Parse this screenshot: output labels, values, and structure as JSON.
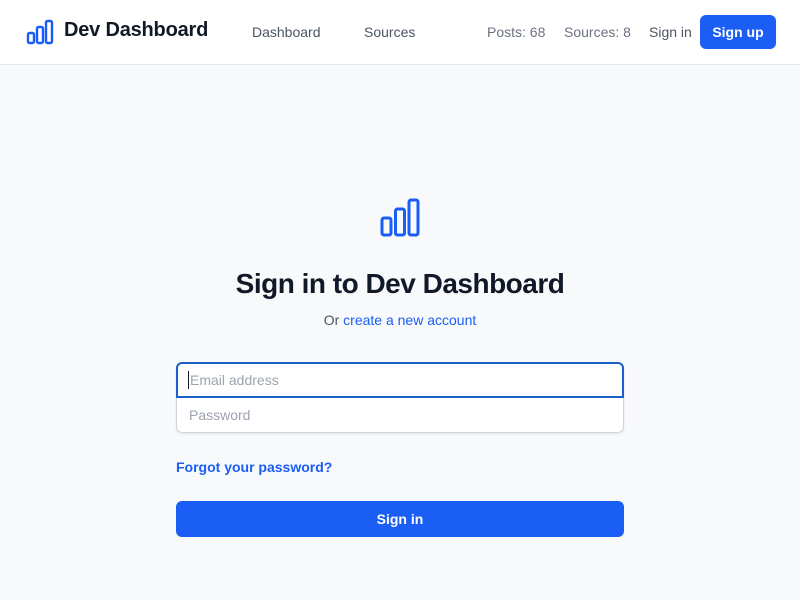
{
  "header": {
    "brand": "Dev Dashboard",
    "nav": {
      "dashboard": "Dashboard",
      "sources": "Sources"
    },
    "stats": {
      "posts": "Posts: 68",
      "sources": "Sources: 8"
    },
    "sign_in": "Sign in",
    "sign_up": "Sign up",
    "logo_icon": "bar-chart-icon"
  },
  "form": {
    "logo_icon": "bar-chart-icon",
    "title": "Sign in to Dev Dashboard",
    "subtitle_prefix": "Or ",
    "subtitle_link": "create a new account",
    "email": {
      "value": "",
      "placeholder": "Email address"
    },
    "password": {
      "value": "",
      "placeholder": "Password"
    },
    "forgot": "Forgot your password?",
    "submit": "Sign in"
  },
  "colors": {
    "accent": "#1a5ef5",
    "focus_border": "#1a5ec8",
    "background": "#f8f9fb",
    "header_bg": "#ffffff",
    "text_primary": "#111827",
    "text_secondary": "#4b5563"
  }
}
